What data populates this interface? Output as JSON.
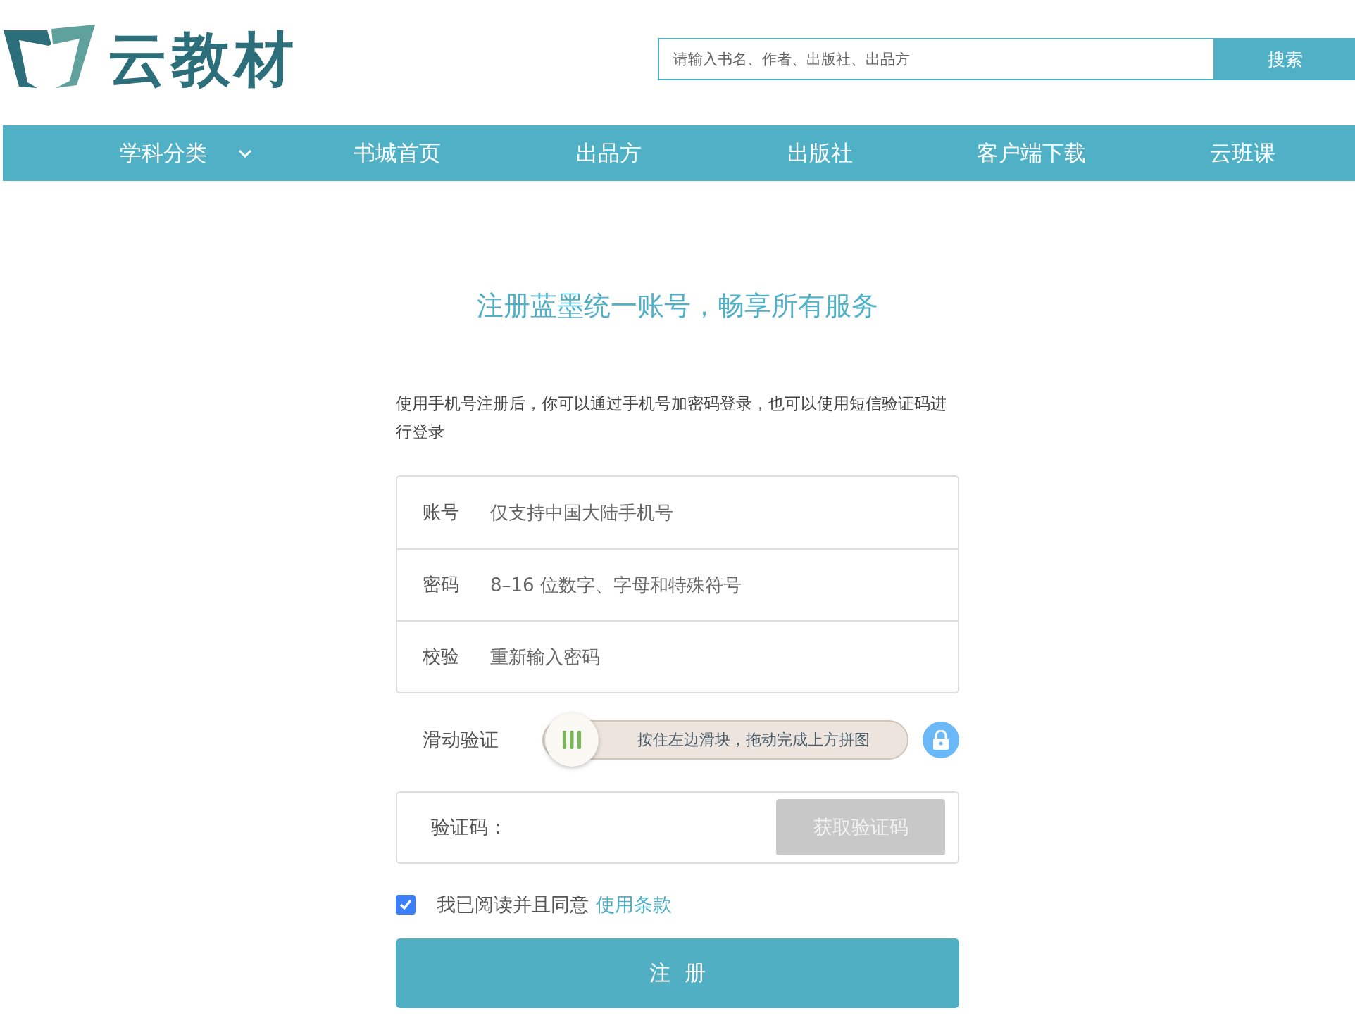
{
  "header": {
    "logo_text": "云教材",
    "search": {
      "placeholder": "请输入书名、作者、出版社、出品方",
      "button": "搜索"
    }
  },
  "nav": [
    {
      "label": "学科分类",
      "kind": "dropdown"
    },
    {
      "label": "书城首页",
      "kind": "link"
    },
    {
      "label": "出品方",
      "kind": "link"
    },
    {
      "label": "出版社",
      "kind": "link"
    },
    {
      "label": "客户端下载",
      "kind": "link"
    },
    {
      "label": "云班课",
      "kind": "link"
    }
  ],
  "title": "注册蓝墨统一账号，畅享所有服务",
  "description": "使用手机号注册后，你可以通过手机号加密码登录，也可以使用短信验证码进行登录",
  "fields": [
    {
      "label": "账号",
      "placeholder": "仅支持中国大陆手机号"
    },
    {
      "label": "密码",
      "placeholder": "8–16 位数字、字母和特殊符号"
    },
    {
      "label": "校验",
      "placeholder": "重新输入密码"
    }
  ],
  "slider": {
    "label": "滑动验证",
    "hint": "按住左边滑块，拖动完成上方拼图"
  },
  "code": {
    "label": "验证码：",
    "button": "获取验证码",
    "disabled": true
  },
  "agree": {
    "checked": true,
    "text": "我已阅读并且同意",
    "link": "使用条款"
  },
  "submit": "注  册"
}
